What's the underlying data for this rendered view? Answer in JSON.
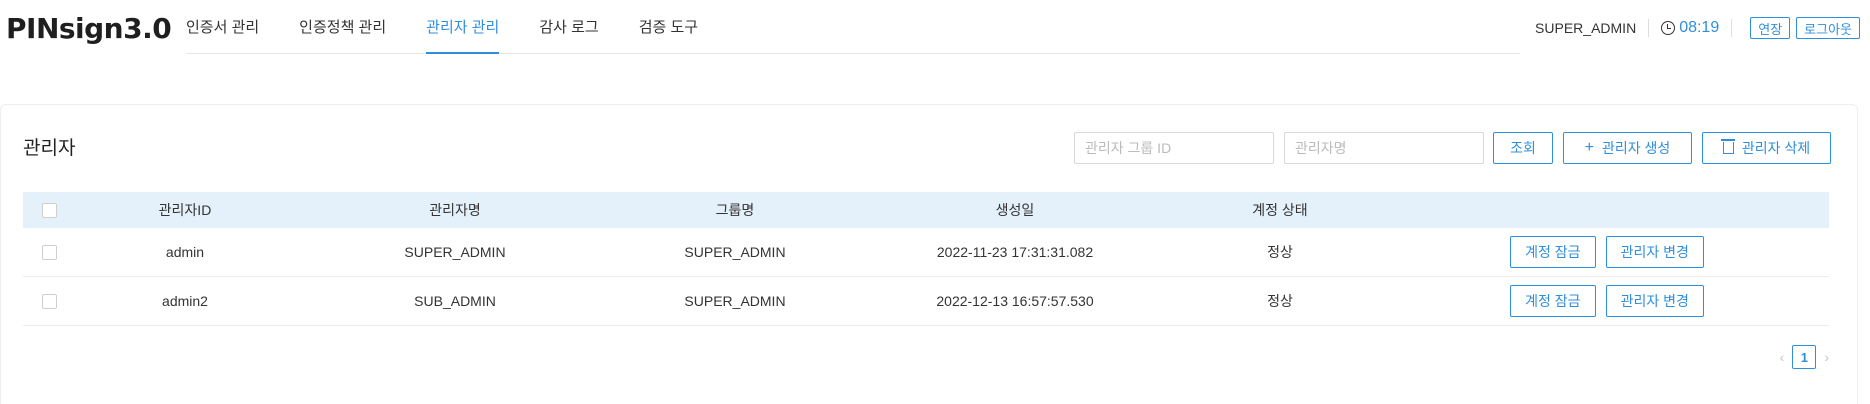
{
  "app": {
    "logo": "PINsign3.0"
  },
  "nav": {
    "items": [
      {
        "label": "인증서 관리",
        "active": false
      },
      {
        "label": "인증정책 관리",
        "active": false
      },
      {
        "label": "관리자 관리",
        "active": true
      },
      {
        "label": "감사 로그",
        "active": false
      },
      {
        "label": "검증 도구",
        "active": false
      }
    ]
  },
  "header": {
    "user": "SUPER_ADMIN",
    "timer": "08:19",
    "extend_label": "연장",
    "logout_label": "로그아웃"
  },
  "page": {
    "title": "관리자",
    "search": {
      "group_id_placeholder": "관리자 그룹 ID",
      "name_placeholder": "관리자명"
    },
    "buttons": {
      "search": "조회",
      "create": "관리자 생성",
      "delete": "관리자 삭제"
    }
  },
  "table": {
    "columns": [
      "관리자ID",
      "관리자명",
      "그룹명",
      "생성일",
      "계정 상태"
    ],
    "rows": [
      {
        "id": "admin",
        "name": "SUPER_ADMIN",
        "group": "SUPER_ADMIN",
        "created": "2022-11-23 17:31:31.082",
        "status": "정상",
        "lock_label": "계정 잠금",
        "change_label": "관리자 변경"
      },
      {
        "id": "admin2",
        "name": "SUB_ADMIN",
        "group": "SUPER_ADMIN",
        "created": "2022-12-13 16:57:57.530",
        "status": "정상",
        "lock_label": "계정 잠금",
        "change_label": "관리자 변경"
      }
    ]
  },
  "pagination": {
    "prev": "‹",
    "current": "1",
    "next": "›"
  },
  "colors": {
    "accent": "#2f8fdd",
    "header_row": "#e4f1fb"
  }
}
